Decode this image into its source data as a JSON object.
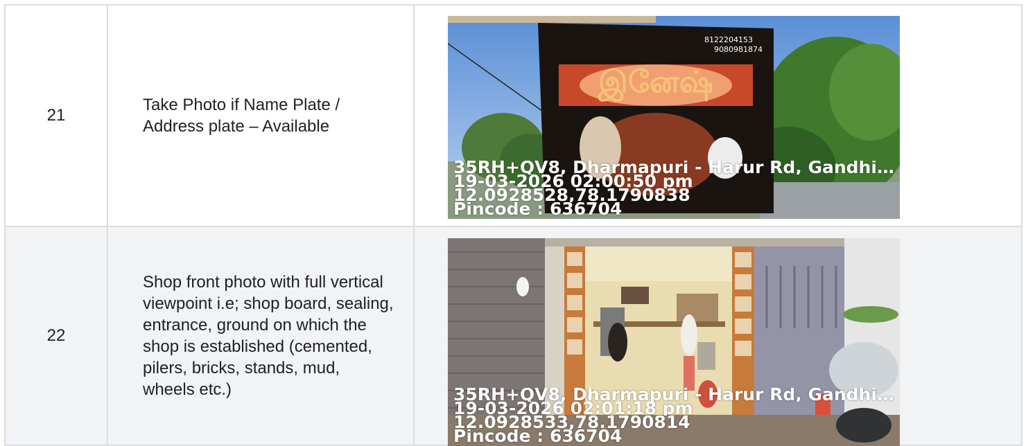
{
  "rows": [
    {
      "number": "21",
      "description": "Take Photo if Name Plate / Address plate – Available",
      "photo": {
        "subject": "shop signboard",
        "sign_phone_1": "8122204153",
        "sign_phone_2": "9080981874",
        "geo_tag": {
          "address": "35RH+QV8, Dharmapuri - Harur Rd, Gandhi ...",
          "datetime": "19-03-2026 02:00:50 pm",
          "coordinates": "12.0928528,78.1790838",
          "pincode": "Pincode : 636704"
        }
      }
    },
    {
      "number": "22",
      "description": "Shop front photo with full vertical viewpoint i.e; shop board, sealing, entrance, ground on which the shop is established (cemented, pilers, bricks, stands, mud, wheels etc.)",
      "photo": {
        "subject": "shop front",
        "geo_tag": {
          "address": "35RH+QV8, Dharmapuri - Harur Rd, Gandhi ...",
          "datetime": "19-03-2026 02:01:18 pm",
          "coordinates": "12.0928533,78.1790814",
          "pincode": "Pincode : 636704"
        }
      }
    }
  ]
}
